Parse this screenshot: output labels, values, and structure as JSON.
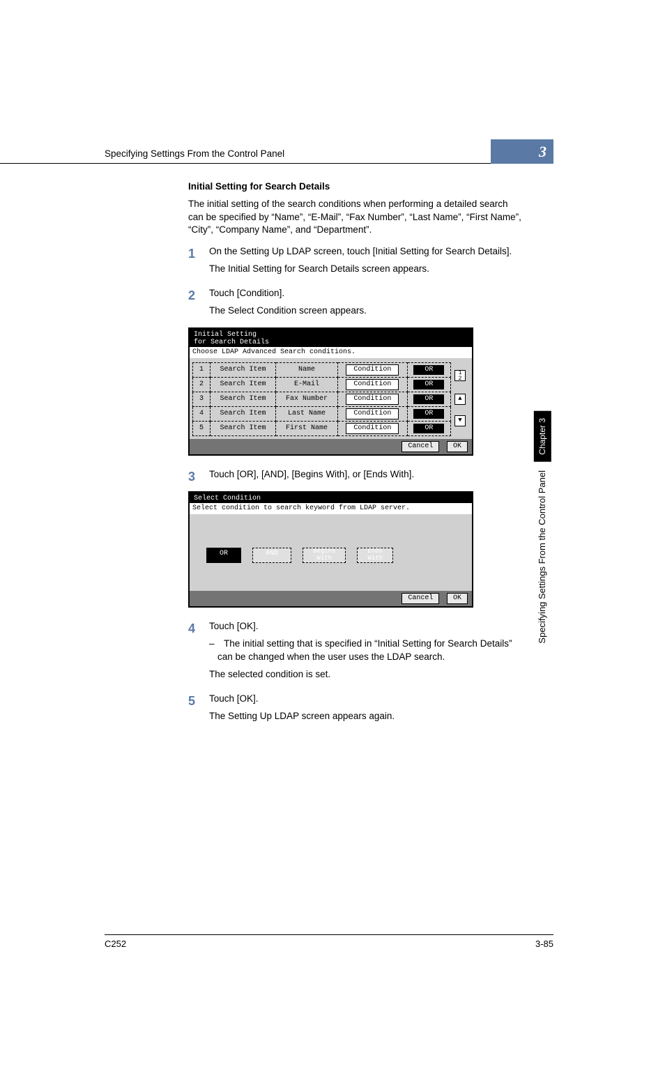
{
  "header": {
    "running_title": "Specifying Settings From the Control Panel",
    "chapter_number": "3"
  },
  "side": {
    "chapter_label": "Chapter 3",
    "section_label": "Specifying Settings From the Control Panel"
  },
  "section": {
    "heading": "Initial Setting for Search Details",
    "intro": "The initial setting of the search conditions when performing a detailed search can be specified by “Name”, “E-Mail”, “Fax Number”, “Last Name”, “First Name”, “City”, “Company Name”, and “Department”."
  },
  "steps": {
    "s1": {
      "num": "1",
      "p1": "On the Setting Up LDAP screen, touch [Initial Setting for Search Details].",
      "p2": "The Initial Setting for Search Details screen appears."
    },
    "s2": {
      "num": "2",
      "p1": "Touch [Condition].",
      "p2": "The Select Condition screen appears."
    },
    "s3": {
      "num": "3",
      "p1": "Touch [OR], [AND], [Begins With], or [Ends With]."
    },
    "s4": {
      "num": "4",
      "p1": "Touch [OK].",
      "bullet": "– The initial setting that is specified in “Initial Setting for Search Details” can be changed when the user uses the LDAP search.",
      "p2": "The selected condition is set."
    },
    "s5": {
      "num": "5",
      "p1": "Touch [OK].",
      "p2": "The Setting Up LDAP screen appears again."
    }
  },
  "panel1": {
    "title1": "Initial Setting",
    "title2": "for Search Details",
    "subtitle": "Choose LDAP Advanced Search conditions.",
    "search_item": "Search Item",
    "cond_btn": "Condition",
    "or_btn": "OR",
    "rows": [
      {
        "n": "1",
        "val": "Name"
      },
      {
        "n": "2",
        "val": "E-Mail"
      },
      {
        "n": "3",
        "val": "Fax Number"
      },
      {
        "n": "4",
        "val": "Last Name"
      },
      {
        "n": "5",
        "val": "First Name"
      }
    ],
    "cancel": "Cancel",
    "ok": "OK",
    "scroll_hint": "1\n2"
  },
  "panel2": {
    "title": "Select Condition",
    "subtitle": "Select condition to search keyword from LDAP server.",
    "opts": {
      "or": "OR",
      "and": "AND",
      "begins": "Begins\nWith",
      "ends": "Ends\nWith"
    },
    "cancel": "Cancel",
    "ok": "OK"
  },
  "footer": {
    "left": "C252",
    "right": "3-85"
  }
}
